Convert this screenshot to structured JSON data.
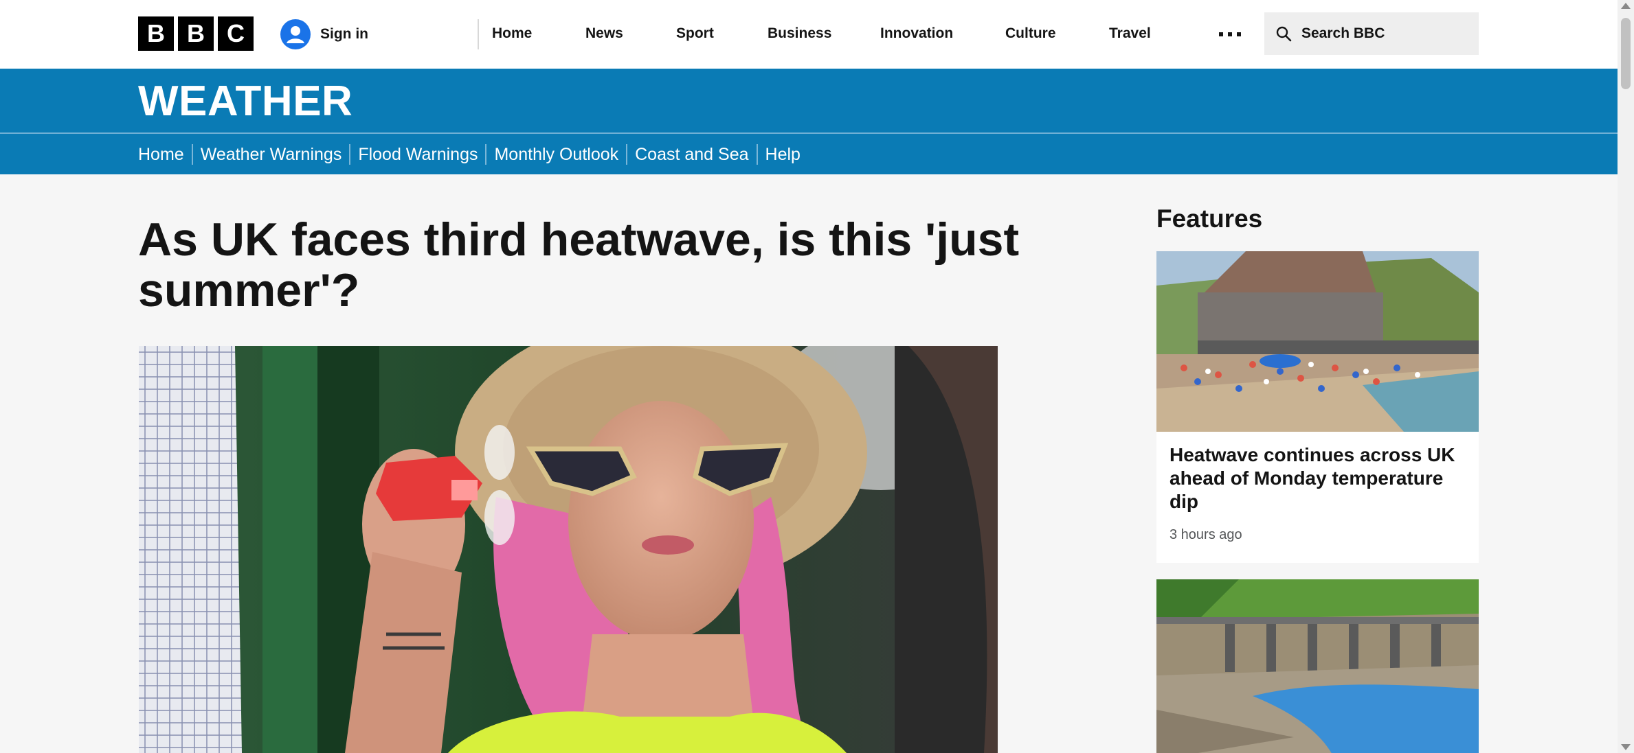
{
  "header": {
    "logo": [
      "B",
      "B",
      "C"
    ],
    "signin_label": "Sign in",
    "nav": [
      "Home",
      "News",
      "Sport",
      "Business",
      "Innovation",
      "Culture",
      "Travel"
    ],
    "more_icon": "ellipsis-icon",
    "search_label": "Search BBC"
  },
  "weather": {
    "title": "WEATHER",
    "subnav": [
      "Home",
      "Weather Warnings",
      "Flood Warnings",
      "Monthly Outlook",
      "Coast and Sea",
      "Help"
    ]
  },
  "article": {
    "headline": "As UK faces third heatwave, is this 'just summer'?",
    "hero_image": "woman-with-hat-sunglasses-and-handheld-fan-photo"
  },
  "features": {
    "title": "Features",
    "cards": [
      {
        "title": "Heatwave continues across UK ahead of Monday temperature dip",
        "time": "3 hours ago",
        "image": "crowded-beach-photo"
      },
      {
        "image": "dried-reservoir-bridge-photo"
      }
    ]
  },
  "colors": {
    "brand_blue": "#0a7bb5",
    "page_bg": "#f6f6f6",
    "signin_blue": "#1a73e8"
  }
}
